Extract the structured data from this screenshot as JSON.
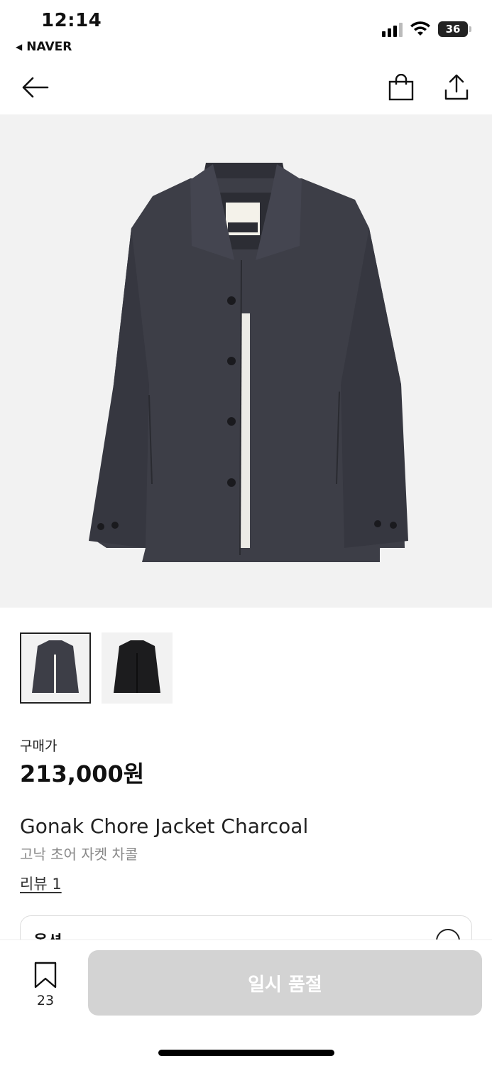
{
  "status_bar": {
    "time": "12:14",
    "back_app": "NAVER",
    "battery": "36"
  },
  "nav": {
    "back_icon": "arrow-left-icon",
    "bag_icon": "shopping-bag-icon",
    "share_icon": "share-icon"
  },
  "product": {
    "price_label": "구매가",
    "price": "213,000원",
    "name_en": "Gonak Chore Jacket Charcoal",
    "name_ko": "고낙 초어 자켓 차콜",
    "review_link": "리뷰 1",
    "option_title": "옵션",
    "thumbnails": [
      "charcoal",
      "black"
    ]
  },
  "bottom": {
    "wishlist_count": "23",
    "soldout_label": "일시 품절"
  },
  "colors": {
    "jacket_charcoal": "#3d3e47",
    "jacket_black": "#1c1c1e",
    "image_bg": "#f2f2f2",
    "disabled_button": "#d3d3d3"
  }
}
